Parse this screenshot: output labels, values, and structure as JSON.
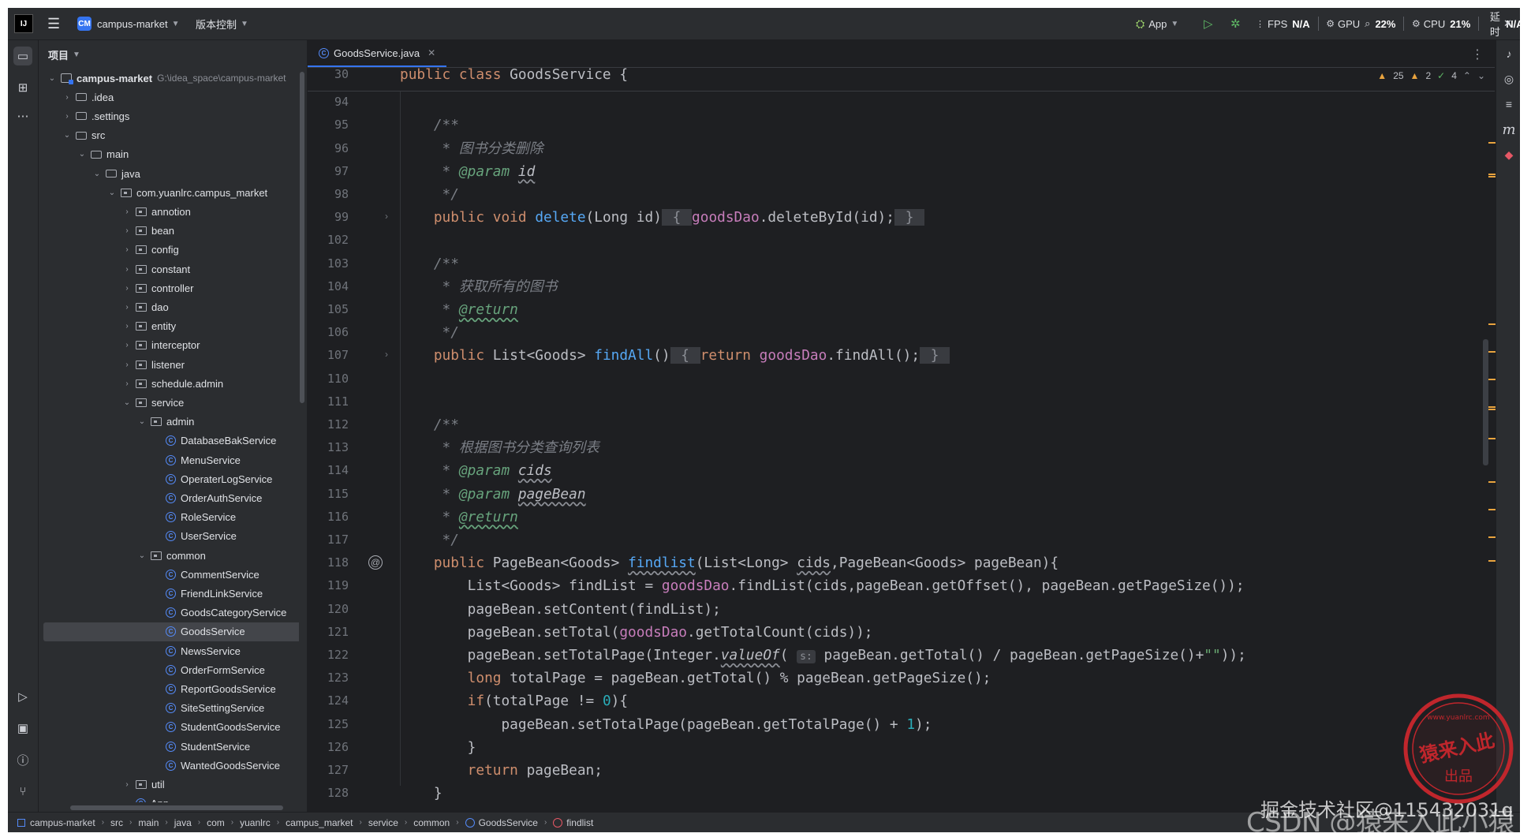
{
  "titlebar": {
    "project_badge": "CM",
    "project_name": "campus-market",
    "vcs_label": "版本控制",
    "run_config": "App",
    "stats": [
      {
        "label": "FPS",
        "value": "N/A"
      },
      {
        "label": "GPU",
        "value": "22%"
      },
      {
        "label": "CPU",
        "value": "21%"
      },
      {
        "label": "延时",
        "value": "N/A"
      }
    ]
  },
  "project_panel": {
    "title": "项目",
    "root_name": "campus-market",
    "root_path": "G:\\idea_space\\campus-market",
    "tree": [
      {
        "label": ".idea",
        "depth": 1,
        "type": "folder",
        "expanded": false
      },
      {
        "label": ".settings",
        "depth": 1,
        "type": "folder",
        "expanded": false
      },
      {
        "label": "src",
        "depth": 1,
        "type": "folder",
        "expanded": true
      },
      {
        "label": "main",
        "depth": 2,
        "type": "folder",
        "expanded": true
      },
      {
        "label": "java",
        "depth": 3,
        "type": "folder",
        "expanded": true
      },
      {
        "label": "com.yuanlrc.campus_market",
        "depth": 4,
        "type": "package",
        "expanded": true
      },
      {
        "label": "annotion",
        "depth": 5,
        "type": "package",
        "expanded": false
      },
      {
        "label": "bean",
        "depth": 5,
        "type": "package",
        "expanded": false
      },
      {
        "label": "config",
        "depth": 5,
        "type": "package",
        "expanded": false
      },
      {
        "label": "constant",
        "depth": 5,
        "type": "package",
        "expanded": false
      },
      {
        "label": "controller",
        "depth": 5,
        "type": "package",
        "expanded": false
      },
      {
        "label": "dao",
        "depth": 5,
        "type": "package",
        "expanded": false
      },
      {
        "label": "entity",
        "depth": 5,
        "type": "package",
        "expanded": false
      },
      {
        "label": "interceptor",
        "depth": 5,
        "type": "package",
        "expanded": false
      },
      {
        "label": "listener",
        "depth": 5,
        "type": "package",
        "expanded": false
      },
      {
        "label": "schedule.admin",
        "depth": 5,
        "type": "package",
        "expanded": false
      },
      {
        "label": "service",
        "depth": 5,
        "type": "package",
        "expanded": true
      },
      {
        "label": "admin",
        "depth": 6,
        "type": "package",
        "expanded": true
      },
      {
        "label": "DatabaseBakService",
        "depth": 7,
        "type": "class"
      },
      {
        "label": "MenuService",
        "depth": 7,
        "type": "class"
      },
      {
        "label": "OperaterLogService",
        "depth": 7,
        "type": "class"
      },
      {
        "label": "OrderAuthService",
        "depth": 7,
        "type": "class"
      },
      {
        "label": "RoleService",
        "depth": 7,
        "type": "class"
      },
      {
        "label": "UserService",
        "depth": 7,
        "type": "class"
      },
      {
        "label": "common",
        "depth": 6,
        "type": "package",
        "expanded": true
      },
      {
        "label": "CommentService",
        "depth": 7,
        "type": "class"
      },
      {
        "label": "FriendLinkService",
        "depth": 7,
        "type": "class"
      },
      {
        "label": "GoodsCategoryService",
        "depth": 7,
        "type": "class"
      },
      {
        "label": "GoodsService",
        "depth": 7,
        "type": "class",
        "selected": true
      },
      {
        "label": "NewsService",
        "depth": 7,
        "type": "class"
      },
      {
        "label": "OrderFormService",
        "depth": 7,
        "type": "class"
      },
      {
        "label": "ReportGoodsService",
        "depth": 7,
        "type": "class"
      },
      {
        "label": "SiteSettingService",
        "depth": 7,
        "type": "class"
      },
      {
        "label": "StudentGoodsService",
        "depth": 7,
        "type": "class"
      },
      {
        "label": "StudentService",
        "depth": 7,
        "type": "class"
      },
      {
        "label": "WantedGoodsService",
        "depth": 7,
        "type": "class"
      },
      {
        "label": "util",
        "depth": 5,
        "type": "package",
        "expanded": false
      },
      {
        "label": "App",
        "depth": 5,
        "type": "class"
      }
    ]
  },
  "editor": {
    "tab_label": "GoodsService.java",
    "inspections": {
      "warnings": "25",
      "weak_warnings": "2",
      "typos": "4"
    },
    "lines": [
      {
        "n": "30",
        "html": "<span class=\"kw\">public class</span> GoodsService {"
      },
      {
        "n": "94",
        "html": ""
      },
      {
        "n": "95",
        "html": "    <span class=\"com\">/**</span>"
      },
      {
        "n": "96",
        "html": "<span class=\"com\">     * 图书分类删除</span>"
      },
      {
        "n": "97",
        "html": "<span class=\"com\">     * </span><span class=\"dtag\">@param</span> <span class=\"dparam\">id</span>"
      },
      {
        "n": "98",
        "html": "<span class=\"com\">     */</span>"
      },
      {
        "n": "99",
        "html": "    <span class=\"kw\">public void</span> <span class=\"fn\">delete</span>(Long id)<span class=\"brace\"> { </span><span class=\"fld\">goodsDao</span>.deleteById(id);<span class=\"brace\"> } </span>"
      },
      {
        "n": "102",
        "html": ""
      },
      {
        "n": "103",
        "html": "    <span class=\"com\">/**</span>"
      },
      {
        "n": "104",
        "html": "<span class=\"com\">     * 获取所有的图书</span>"
      },
      {
        "n": "105",
        "html": "<span class=\"com\">     * </span><span class=\"dtagu\">@return</span>"
      },
      {
        "n": "106",
        "html": "<span class=\"com\">     */</span>"
      },
      {
        "n": "107",
        "html": "    <span class=\"kw\">public</span> List&lt;Goods&gt; <span class=\"fn\">findAll</span>()<span class=\"brace\"> { </span><span class=\"kw\">return</span> <span class=\"fld\">goodsDao</span>.findAll();<span class=\"brace\"> } </span>"
      },
      {
        "n": "110",
        "html": ""
      },
      {
        "n": "111",
        "html": ""
      },
      {
        "n": "112",
        "html": "    <span class=\"com\">/**</span>"
      },
      {
        "n": "113",
        "html": "<span class=\"com\">     * 根据图书分类查询列表</span>"
      },
      {
        "n": "114",
        "html": "<span class=\"com\">     * </span><span class=\"dtag\">@param</span> <span class=\"dparam\">cids</span>"
      },
      {
        "n": "115",
        "html": "<span class=\"com\">     * </span><span class=\"dtag\">@param</span> <span class=\"dparam\">pageBean</span>"
      },
      {
        "n": "116",
        "html": "<span class=\"com\">     * </span><span class=\"dtagu\">@return</span>"
      },
      {
        "n": "117",
        "html": "<span class=\"com\">     */</span>"
      },
      {
        "n": "118",
        "html": "    <span class=\"kw\">public</span> PageBean&lt;Goods&gt; <span class=\"fnu\">findlist</span>(List&lt;Long&gt; <span class=\"und\">cids</span>,PageBean&lt;Goods&gt; pageBean){"
      },
      {
        "n": "119",
        "html": "        List&lt;Goods&gt; findList = <span class=\"fld\">goodsDao</span>.findList(cids,pageBean.getOffset(), pageBean.getPageSize());"
      },
      {
        "n": "120",
        "html": "        pageBean.setContent(findList);"
      },
      {
        "n": "121",
        "html": "        pageBean.setTotal(<span class=\"fld\">goodsDao</span>.getTotalCount(cids));"
      },
      {
        "n": "122",
        "html": "        pageBean.setTotalPage(Integer.<span class=\"itl\">valueOf</span>( <span class=\"hint\">s:</span> pageBean.getTotal() / pageBean.getPageSize()+<span class=\"str\">\"\"</span>));"
      },
      {
        "n": "123",
        "html": "        <span class=\"kw\">long</span> totalPage = pageBean.getTotal() % pageBean.getPageSize();"
      },
      {
        "n": "124",
        "html": "        <span class=\"kw\">if</span>(totalPage != <span class=\"num\">0</span>){"
      },
      {
        "n": "125",
        "html": "            pageBean.setTotalPage(pageBean.getTotalPage() + <span class=\"num\">1</span>);"
      },
      {
        "n": "126",
        "html": "        }"
      },
      {
        "n": "127",
        "html": "        <span class=\"kw\">return</span> pageBean;"
      },
      {
        "n": "128",
        "html": "    }"
      }
    ]
  },
  "statusbar": {
    "breadcrumbs": [
      "campus-market",
      "src",
      "main",
      "java",
      "com",
      "yuanlrc",
      "campus_market",
      "service",
      "common",
      "GoodsService",
      "findlist"
    ]
  },
  "watermark": {
    "text": "CSDN @猿来入此小猿",
    "overlay": "掘金技术社区@115432031q",
    "seal_text": "猿来入此",
    "seal_sub": "出品",
    "seal_url": "www.yuanlrc.com"
  },
  "colors": {
    "accent": "#3574f0",
    "keyword": "#cf8e6d",
    "function": "#56a8f5",
    "field": "#c77dbb",
    "comment": "#7a7e85",
    "warning": "#e8a33e"
  }
}
